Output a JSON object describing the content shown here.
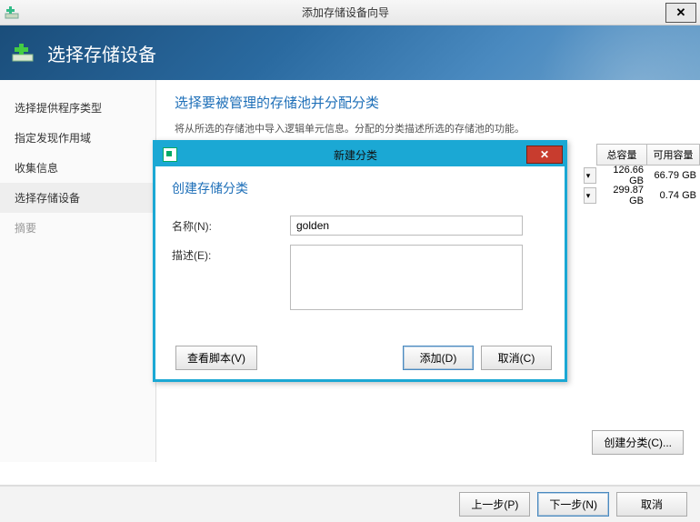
{
  "window": {
    "title": "添加存储设备向导"
  },
  "banner": {
    "title": "选择存储设备"
  },
  "sidebar": {
    "items": [
      {
        "label": "选择提供程序类型"
      },
      {
        "label": "指定发现作用域"
      },
      {
        "label": "收集信息"
      },
      {
        "label": "选择存储设备"
      },
      {
        "label": "摘要"
      }
    ]
  },
  "content": {
    "heading": "选择要被管理的存储池并分配分类",
    "blurb": "将从所选的存储池中导入逻辑单元信息。分配的分类描述所选的存储池的功能。"
  },
  "table": {
    "headers": [
      "总容量",
      "可用容量"
    ],
    "rows": [
      {
        "total": "126.66 GB",
        "free": "66.79 GB"
      },
      {
        "total": "299.87 GB",
        "free": "0.74 GB"
      }
    ]
  },
  "buttons": {
    "create_category": "创建分类(C)...",
    "prev": "上一步(P)",
    "next": "下一步(N)",
    "cancel": "取消"
  },
  "dialog": {
    "title": "新建分类",
    "heading": "创建存储分类",
    "name_label": "名称(N):",
    "name_value": "golden",
    "desc_label": "描述(E):",
    "desc_value": "",
    "view_script": "查看脚本(V)",
    "add": "添加(D)",
    "cancel": "取消(C)"
  }
}
